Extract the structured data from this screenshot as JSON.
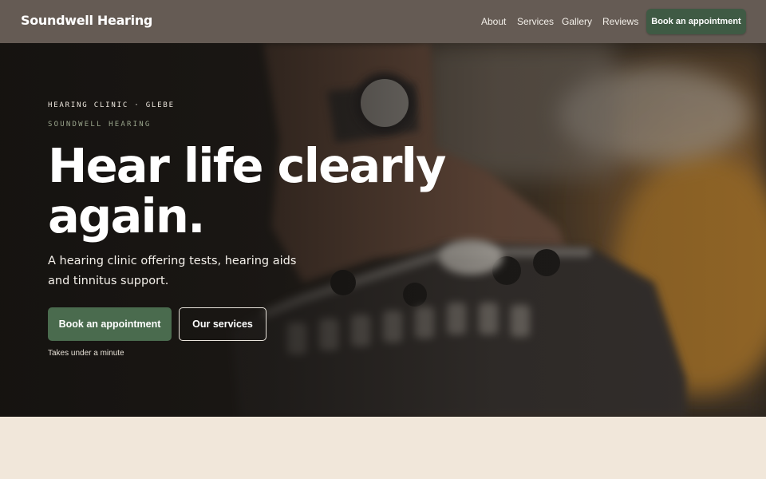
{
  "header": {
    "brand": "Soundwell Hearing",
    "nav": [
      "About",
      "Services",
      "Gallery",
      "Reviews"
    ],
    "cta_label": "Book an appointment"
  },
  "hero": {
    "eyebrow": "HEARING CLINIC · GLEBE",
    "eyebrow_secondary": "SOUNDWELL HEARING",
    "title": "Hear life clearly again.",
    "subtitle": "A hearing clinic offering tests, hearing aids and tinnitus support.",
    "primary_button": "Book an appointment",
    "secondary_button": "Our services",
    "hint": "Takes under a minute",
    "image_subject": "hands-on-audio-mixer-photo"
  },
  "colors": {
    "header_bg": "#655b54",
    "brand_green": "#4a6b4e",
    "page_bg": "#f1e7da"
  }
}
